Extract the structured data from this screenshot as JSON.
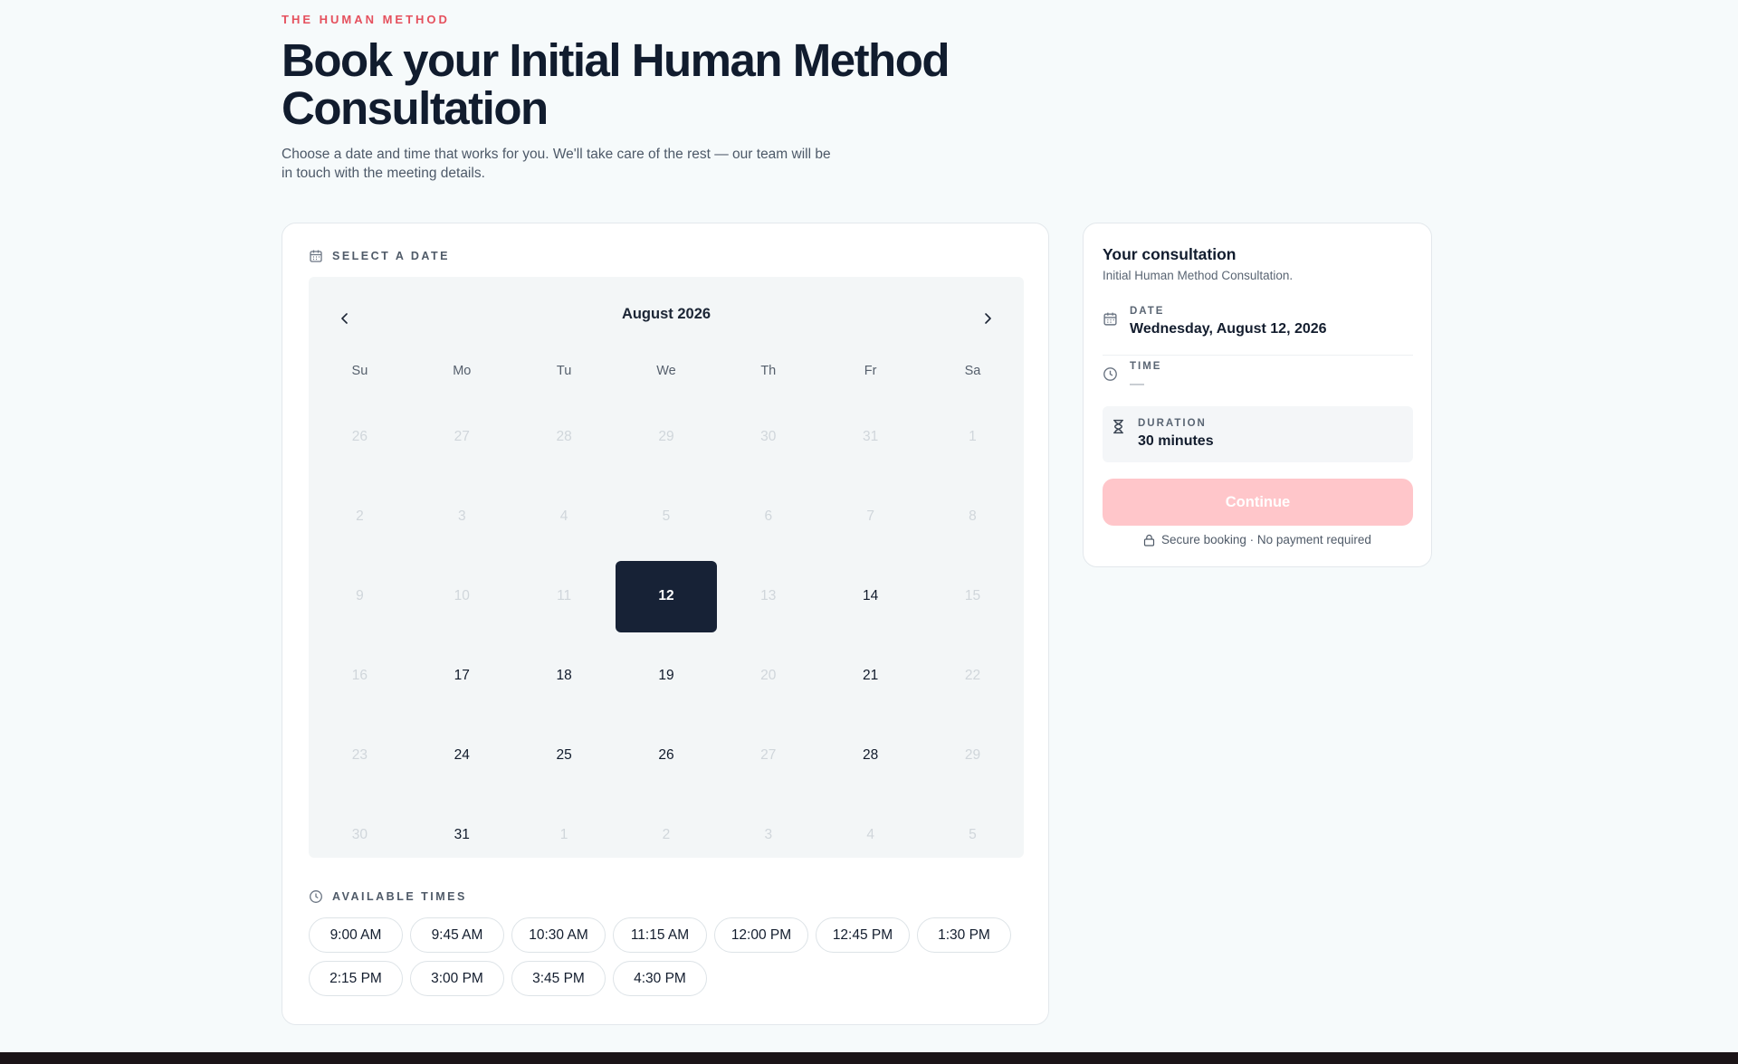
{
  "header": {
    "eyebrow": "THE HUMAN METHOD",
    "title": "Book your Initial Human Method Consultation",
    "subtitle": "Choose a date and time that works for you. We'll take care of the rest — our team will be in touch with the meeting details."
  },
  "calendar": {
    "section_label": "SELECT A DATE",
    "month_label": "August 2026",
    "prev_icon": "chevron-left-icon",
    "next_icon": "chevron-right-icon",
    "weekdays": [
      "Su",
      "Mo",
      "Tu",
      "We",
      "Th",
      "Fr",
      "Sa"
    ],
    "weeks": [
      [
        {
          "d": "26",
          "s": "out"
        },
        {
          "d": "27",
          "s": "out"
        },
        {
          "d": "28",
          "s": "out"
        },
        {
          "d": "29",
          "s": "out"
        },
        {
          "d": "30",
          "s": "out"
        },
        {
          "d": "31",
          "s": "out"
        },
        {
          "d": "1",
          "s": "out"
        }
      ],
      [
        {
          "d": "2",
          "s": "off"
        },
        {
          "d": "3",
          "s": "off"
        },
        {
          "d": "4",
          "s": "off"
        },
        {
          "d": "5",
          "s": "off"
        },
        {
          "d": "6",
          "s": "off"
        },
        {
          "d": "7",
          "s": "off"
        },
        {
          "d": "8",
          "s": "off"
        }
      ],
      [
        {
          "d": "9",
          "s": "off"
        },
        {
          "d": "10",
          "s": "off"
        },
        {
          "d": "11",
          "s": "off"
        },
        {
          "d": "12",
          "s": "selected"
        },
        {
          "d": "13",
          "s": "off"
        },
        {
          "d": "14",
          "s": "avail"
        },
        {
          "d": "15",
          "s": "off"
        }
      ],
      [
        {
          "d": "16",
          "s": "off"
        },
        {
          "d": "17",
          "s": "avail"
        },
        {
          "d": "18",
          "s": "avail"
        },
        {
          "d": "19",
          "s": "avail"
        },
        {
          "d": "20",
          "s": "off"
        },
        {
          "d": "21",
          "s": "avail"
        },
        {
          "d": "22",
          "s": "off"
        }
      ],
      [
        {
          "d": "23",
          "s": "off"
        },
        {
          "d": "24",
          "s": "avail"
        },
        {
          "d": "25",
          "s": "avail"
        },
        {
          "d": "26",
          "s": "avail"
        },
        {
          "d": "27",
          "s": "off"
        },
        {
          "d": "28",
          "s": "avail"
        },
        {
          "d": "29",
          "s": "off"
        }
      ],
      [
        {
          "d": "30",
          "s": "off"
        },
        {
          "d": "31",
          "s": "avail"
        },
        {
          "d": "1",
          "s": "out"
        },
        {
          "d": "2",
          "s": "out"
        },
        {
          "d": "3",
          "s": "out"
        },
        {
          "d": "4",
          "s": "out"
        },
        {
          "d": "5",
          "s": "out"
        }
      ]
    ]
  },
  "times": {
    "section_label": "AVAILABLE TIMES",
    "slots": [
      "9:00 AM",
      "9:45 AM",
      "10:30 AM",
      "11:15 AM",
      "12:00 PM",
      "12:45 PM",
      "1:30 PM",
      "2:15 PM",
      "3:00 PM",
      "3:45 PM",
      "4:30 PM"
    ]
  },
  "summary": {
    "title": "Your consultation",
    "subtitle": "Initial Human Method Consultation.",
    "date_label": "DATE",
    "date_value": "Wednesday, August 12, 2026",
    "time_label": "TIME",
    "time_value": "—",
    "duration_label": "DURATION",
    "duration_value": "30 minutes",
    "continue_label": "Continue",
    "secure_note": "Secure booking · No payment required"
  },
  "colors": {
    "accent": "#e5505d",
    "selected_day": "#172236",
    "continue_disabled": "#ffc6ca"
  }
}
